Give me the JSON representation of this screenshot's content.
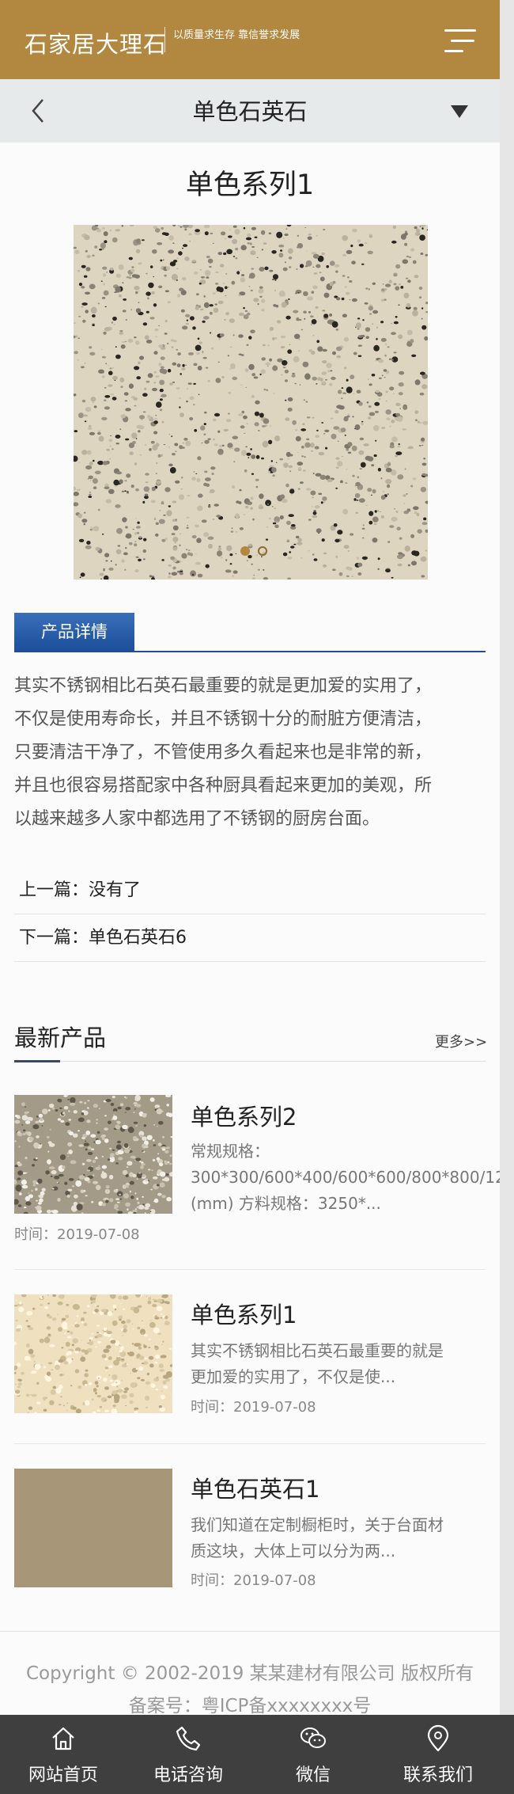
{
  "header": {
    "logo": "石家居大理石",
    "slogan": "以质量求生存 靠信誉求发展",
    "menu_icon": "menu-icon",
    "brand_color": "#b2873f"
  },
  "category_bar": {
    "title": "单色石英石",
    "back_icon": "chevron-left-icon",
    "toggle_icon": "caret-down-icon"
  },
  "product": {
    "title": "单色系列1",
    "slides_total": 2,
    "active_slide": 1
  },
  "detail_tab": {
    "label": "产品详情",
    "accent": "#1d4f9a",
    "description_lines": [
      "其实不锈钢相比石英石最重要的就是更加爱的实用了，",
      "不仅是使用寿命长，并且不锈钢十分的耐脏方便清洁，",
      "只要清洁干净了，不管使用多久看起来也是非常的新，",
      "并且也很容易搭配家中各种厨具看起来更加的美观，所",
      "以越来越多人家中都选用了不锈钢的厨房台面。"
    ]
  },
  "prev_next": {
    "prev": "上一篇：没有了",
    "next": "下一篇：单色石英石6"
  },
  "latest": {
    "title": "最新产品",
    "more": "更多>>",
    "items": [
      {
        "name": "单色系列2",
        "desc_lines": [
          "常规规格：",
          "300*300/600*400/600*600/800*800/12",
          "(mm) 方料规格：3250*..."
        ],
        "time": "时间：2019-07-08"
      },
      {
        "name": "单色系列1",
        "desc_lines": [
          "其实不锈钢相比石英石最重要的就是",
          "更加爱的实用了，不仅是使..."
        ],
        "time": "时间：2019-07-08"
      },
      {
        "name": "单色石英石1",
        "desc_lines": [
          "我们知道在定制橱柜时，关于台面材",
          "质这块，大体上可以分为两..."
        ],
        "time": "时间：2019-07-08"
      }
    ]
  },
  "footer": {
    "copyright": "Copyright © 2002-2019 某某建材有限公司 版权所有",
    "icp": "备案号：粤ICP备xxxxxxxx号"
  },
  "bottom_nav": [
    {
      "label": "网站首页",
      "icon": "home-icon"
    },
    {
      "label": "电话咨询",
      "icon": "phone-icon"
    },
    {
      "label": "微信",
      "icon": "wechat-icon"
    },
    {
      "label": "联系我们",
      "icon": "location-icon"
    }
  ]
}
